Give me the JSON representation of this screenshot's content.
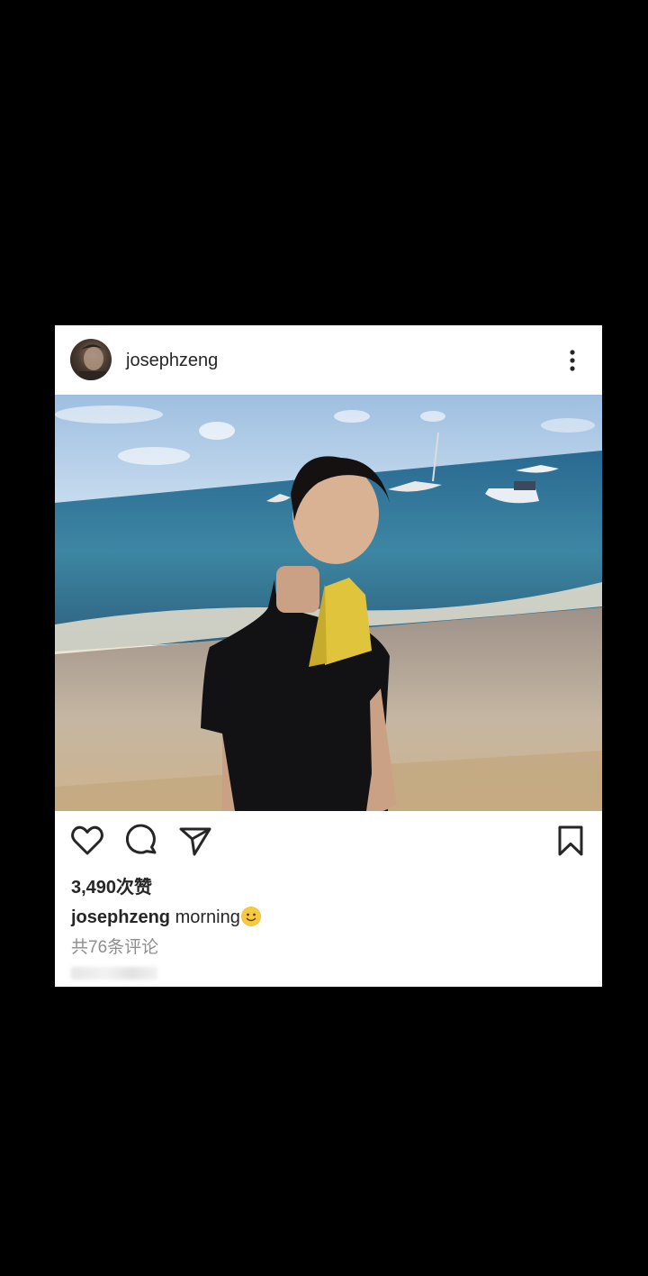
{
  "post": {
    "username": "josephzeng",
    "likes": "3,490次赞",
    "caption_user": "josephzeng",
    "caption_text": "morning",
    "caption_emoji": "smiling-face-emoji",
    "comments": "共76条评论"
  },
  "icons": {
    "more": "more-vertical-icon",
    "like": "heart-icon",
    "comment": "comment-bubble-icon",
    "share": "paper-plane-icon",
    "save": "bookmark-icon"
  },
  "colors": {
    "background": "#000000",
    "card": "#ffffff",
    "text": "#262626",
    "muted": "#8e8e8e"
  }
}
